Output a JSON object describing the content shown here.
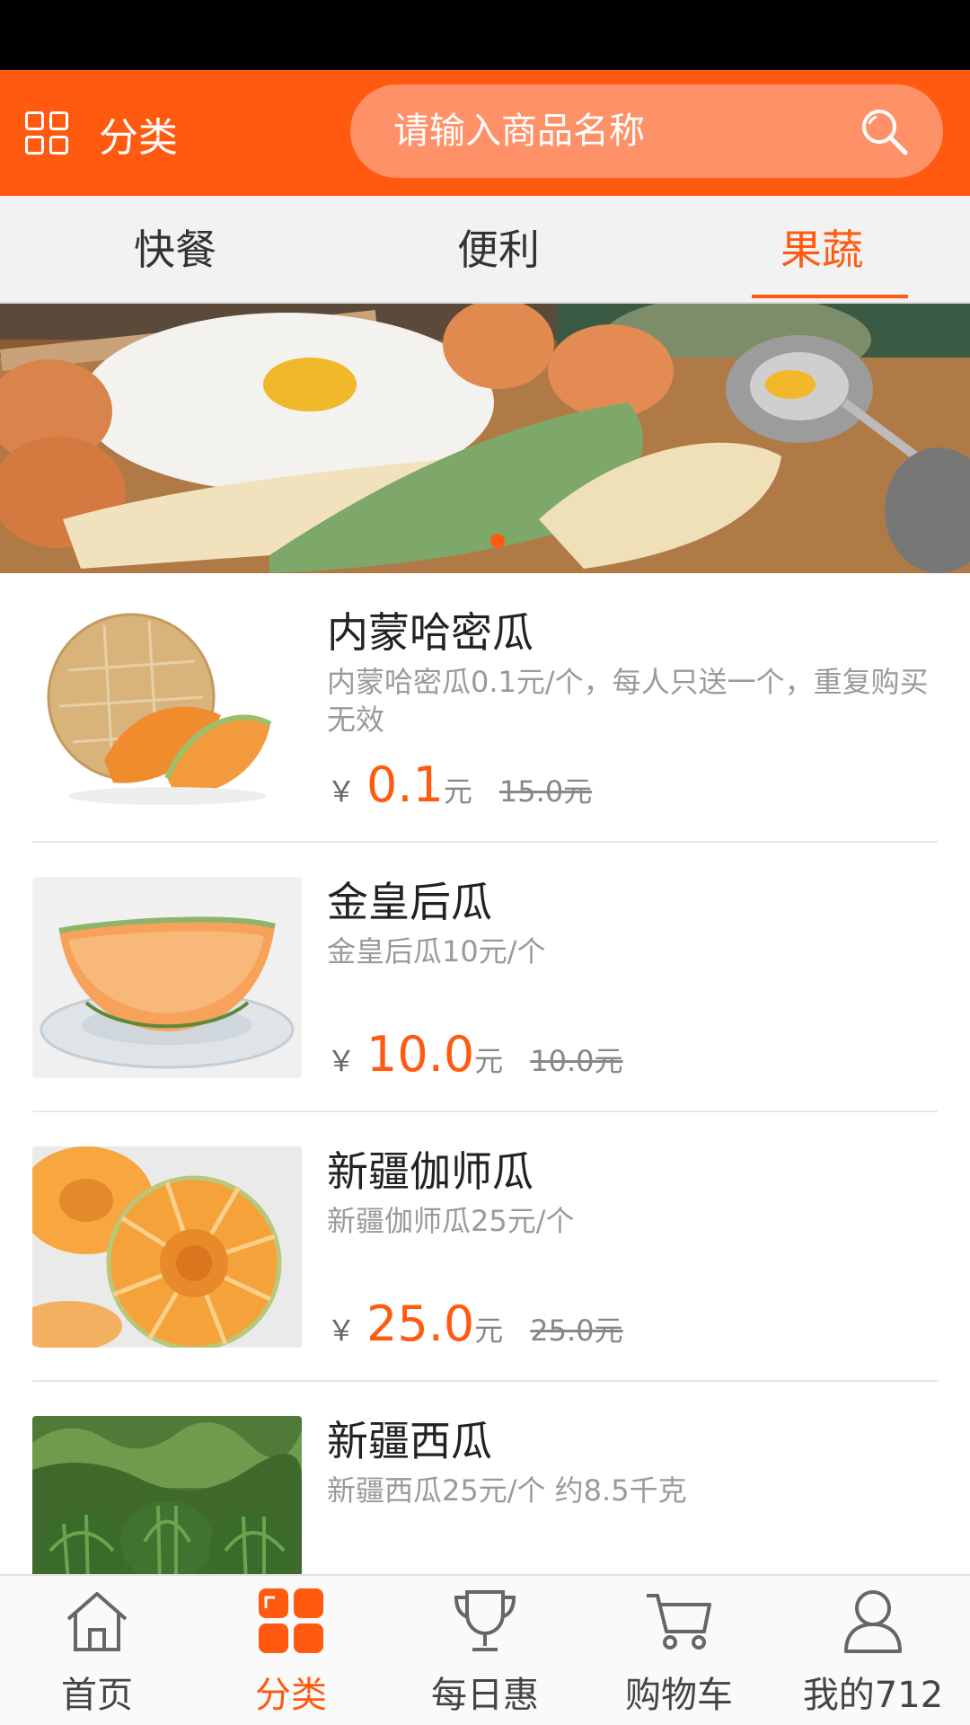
{
  "header": {
    "category_label": "分类",
    "search_placeholder": "请输入商品名称"
  },
  "tabs": [
    {
      "label": "快餐",
      "active": false
    },
    {
      "label": "便利",
      "active": false
    },
    {
      "label": "果蔬",
      "active": true
    }
  ],
  "banner": {
    "slide_index": 1,
    "slide_count": 1
  },
  "products": [
    {
      "name": "内蒙哈密瓜",
      "desc": "内蒙哈密瓜0.1元/个，每人只送一个，重复购买无效",
      "yen": "￥",
      "price": "0.1",
      "unit": "元",
      "original": "15.0元"
    },
    {
      "name": "金皇后瓜",
      "desc": "金皇后瓜10元/个",
      "yen": "￥",
      "price": "10.0",
      "unit": "元",
      "original": "10.0元"
    },
    {
      "name": "新疆伽师瓜",
      "desc": "新疆伽师瓜25元/个",
      "yen": "￥",
      "price": "25.0",
      "unit": "元",
      "original": "25.0元"
    },
    {
      "name": "新疆西瓜",
      "desc": "新疆西瓜25元/个 约8.5千克",
      "yen": "",
      "price": "",
      "unit": "",
      "original": ""
    }
  ],
  "bottom_nav": [
    {
      "label": "首页",
      "icon": "home-icon",
      "active": false
    },
    {
      "label": "分类",
      "icon": "category-grid-icon",
      "active": true
    },
    {
      "label": "每日惠",
      "icon": "trophy-icon",
      "active": false
    },
    {
      "label": "购物车",
      "icon": "cart-icon",
      "active": false
    },
    {
      "label": "我的712",
      "icon": "user-icon",
      "active": false
    }
  ],
  "colors": {
    "accent": "#ff5a10",
    "search_bg": "#ff9168",
    "tab_bg": "#f2f2f2"
  }
}
